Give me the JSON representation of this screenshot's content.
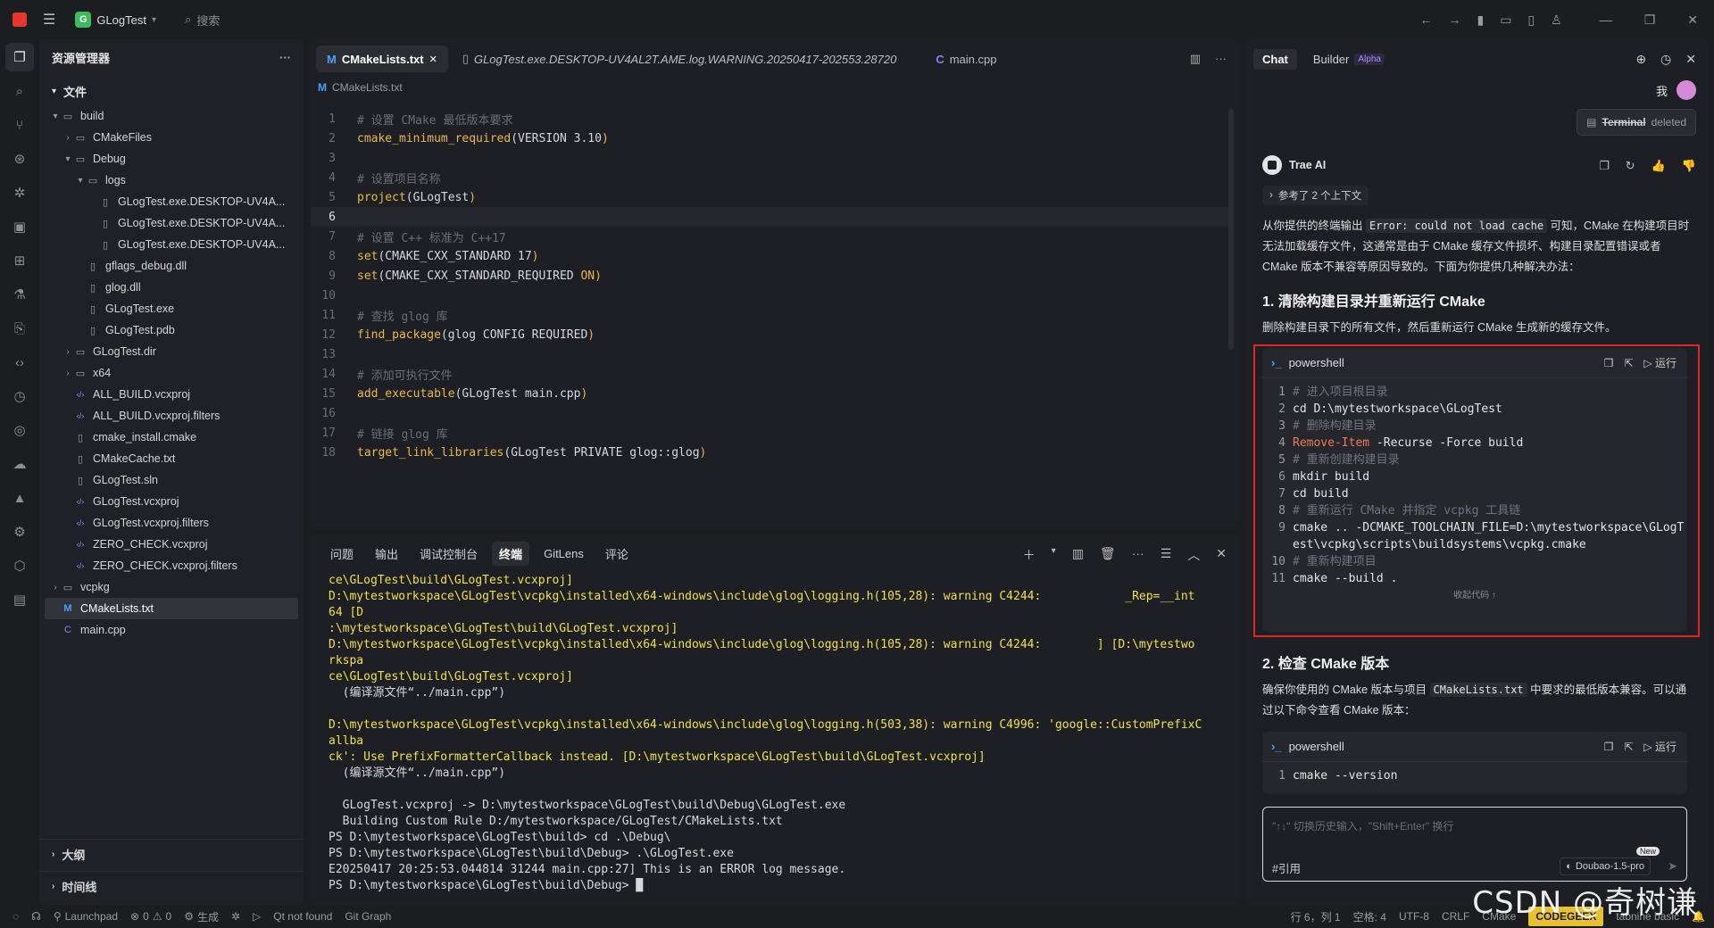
{
  "titlebar": {
    "project": "GLogTest",
    "project_badge": "G",
    "search_label": "搜索"
  },
  "explorer": {
    "header": "资源管理器",
    "section": "文件",
    "tree": [
      {
        "label": "build",
        "depth": 0,
        "kind": "folder",
        "open": true
      },
      {
        "label": "CMakeFiles",
        "depth": 1,
        "kind": "folder",
        "open": false
      },
      {
        "label": "Debug",
        "depth": 1,
        "kind": "folder",
        "open": true
      },
      {
        "label": "logs",
        "depth": 2,
        "kind": "folder",
        "open": true
      },
      {
        "label": "GLogTest.exe.DESKTOP-UV4A...",
        "depth": 3,
        "kind": "file"
      },
      {
        "label": "GLogTest.exe.DESKTOP-UV4A...",
        "depth": 3,
        "kind": "file"
      },
      {
        "label": "GLogTest.exe.DESKTOP-UV4A...",
        "depth": 3,
        "kind": "file"
      },
      {
        "label": "gflags_debug.dll",
        "depth": 2,
        "kind": "file"
      },
      {
        "label": "glog.dll",
        "depth": 2,
        "kind": "file"
      },
      {
        "label": "GLogTest.exe",
        "depth": 2,
        "kind": "file"
      },
      {
        "label": "GLogTest.pdb",
        "depth": 2,
        "kind": "file"
      },
      {
        "label": "GLogTest.dir",
        "depth": 1,
        "kind": "folder",
        "open": false
      },
      {
        "label": "x64",
        "depth": 1,
        "kind": "folder",
        "open": false
      },
      {
        "label": "ALL_BUILD.vcxproj",
        "depth": 1,
        "kind": "xml"
      },
      {
        "label": "ALL_BUILD.vcxproj.filters",
        "depth": 1,
        "kind": "xml"
      },
      {
        "label": "cmake_install.cmake",
        "depth": 1,
        "kind": "file"
      },
      {
        "label": "CMakeCache.txt",
        "depth": 1,
        "kind": "file"
      },
      {
        "label": "GLogTest.sln",
        "depth": 1,
        "kind": "file"
      },
      {
        "label": "GLogTest.vcxproj",
        "depth": 1,
        "kind": "xml"
      },
      {
        "label": "GLogTest.vcxproj.filters",
        "depth": 1,
        "kind": "xml"
      },
      {
        "label": "ZERO_CHECK.vcxproj",
        "depth": 1,
        "kind": "xml"
      },
      {
        "label": "ZERO_CHECK.vcxproj.filters",
        "depth": 1,
        "kind": "xml"
      },
      {
        "label": "vcpkg",
        "depth": 0,
        "kind": "folder",
        "open": false
      },
      {
        "label": "CMakeLists.txt",
        "depth": 0,
        "kind": "cmake",
        "selected": true
      },
      {
        "label": "main.cpp",
        "depth": 0,
        "kind": "cpp"
      }
    ],
    "outline": "大纲",
    "timeline": "时间线"
  },
  "editor": {
    "tabs": [
      {
        "label": "CMakeLists.txt",
        "icon": "M",
        "active": true
      },
      {
        "label": "GLogTest.exe.DESKTOP-UV4AL2T.AME.log.WARNING.20250417-202553.28720",
        "icon": "file",
        "italic": true
      },
      {
        "label": "main.cpp",
        "icon": "cpp"
      }
    ],
    "breadcrumb": "CMakeLists.txt",
    "lines": [
      {
        "n": "1",
        "parts": [
          {
            "c": "cm",
            "t": "# 设置 CMake 最低版本要求"
          }
        ]
      },
      {
        "n": "2",
        "parts": [
          {
            "c": "fn",
            "t": "cmake_minimum_required"
          },
          {
            "c": "tx",
            "t": "(VERSION 3.10"
          },
          {
            "c": "fn",
            "t": ")"
          }
        ]
      },
      {
        "n": "3",
        "parts": []
      },
      {
        "n": "4",
        "parts": [
          {
            "c": "cm",
            "t": "# 设置项目名称"
          }
        ]
      },
      {
        "n": "5",
        "parts": [
          {
            "c": "fn",
            "t": "project"
          },
          {
            "c": "tx",
            "t": "(GLogTest"
          },
          {
            "c": "fn",
            "t": ")"
          }
        ]
      },
      {
        "n": "6",
        "parts": [],
        "current": true
      },
      {
        "n": "7",
        "parts": [
          {
            "c": "cm",
            "t": "# 设置 C++ 标准为 C++17"
          }
        ]
      },
      {
        "n": "8",
        "parts": [
          {
            "c": "fn",
            "t": "set"
          },
          {
            "c": "tx",
            "t": "(CMAKE_CXX_STANDARD 17"
          },
          {
            "c": "fn",
            "t": ")"
          }
        ]
      },
      {
        "n": "9",
        "parts": [
          {
            "c": "fn",
            "t": "set"
          },
          {
            "c": "tx",
            "t": "(CMAKE_CXX_STANDARD_REQUIRED "
          },
          {
            "c": "kw",
            "t": "ON"
          },
          {
            "c": "fn",
            "t": ")"
          }
        ]
      },
      {
        "n": "10",
        "parts": []
      },
      {
        "n": "11",
        "parts": [
          {
            "c": "cm",
            "t": "# 查找 glog 库"
          }
        ]
      },
      {
        "n": "12",
        "parts": [
          {
            "c": "fn",
            "t": "find_package"
          },
          {
            "c": "tx",
            "t": "(glog CONFIG REQUIRED"
          },
          {
            "c": "fn",
            "t": ")"
          }
        ]
      },
      {
        "n": "13",
        "parts": []
      },
      {
        "n": "14",
        "parts": [
          {
            "c": "cm",
            "t": "# 添加可执行文件"
          }
        ]
      },
      {
        "n": "15",
        "parts": [
          {
            "c": "fn",
            "t": "add_executable"
          },
          {
            "c": "tx",
            "t": "(GLogTest main.cpp"
          },
          {
            "c": "fn",
            "t": ")"
          }
        ]
      },
      {
        "n": "16",
        "parts": []
      },
      {
        "n": "17",
        "parts": [
          {
            "c": "cm",
            "t": "# 链接 glog 库"
          }
        ]
      },
      {
        "n": "18",
        "parts": [
          {
            "c": "fn",
            "t": "target_link_libraries"
          },
          {
            "c": "tx",
            "t": "(GLogTest PRIVATE glog::glog"
          },
          {
            "c": "fn",
            "t": ")"
          }
        ]
      }
    ]
  },
  "panel": {
    "tabs": [
      "问题",
      "输出",
      "调试控制台",
      "终端",
      "GitLens",
      "评论"
    ],
    "active_tab": "终端",
    "terminal_lines": [
      {
        "c": "ty",
        "t": "ce\\GLogTest\\build\\GLogTest.vcxproj]"
      },
      {
        "c": "ty",
        "t": "D:\\mytestworkspace\\GLogTest\\vcpkg\\installed\\x64-windows\\include\\glog\\logging.h(105,28): warning C4244:            _Rep=__int"
      },
      {
        "c": "ty",
        "t": "64 [D"
      },
      {
        "c": "ty",
        "t": ":\\mytestworkspace\\GLogTest\\build\\GLogTest.vcxproj]"
      },
      {
        "c": "ty",
        "t": "D:\\mytestworkspace\\GLogTest\\vcpkg\\installed\\x64-windows\\include\\glog\\logging.h(105,28): warning C4244:        ] [D:\\mytestwo"
      },
      {
        "c": "ty",
        "t": "rkspa"
      },
      {
        "c": "ty",
        "t": "ce\\GLogTest\\build\\GLogTest.vcxproj]"
      },
      {
        "c": "tw2",
        "t": "  (编译源文件“../main.cpp”)"
      },
      {
        "c": "tw2",
        "t": ""
      },
      {
        "c": "ty",
        "t": "D:\\mytestworkspace\\GLogTest\\vcpkg\\installed\\x64-windows\\include\\glog\\logging.h(503,38): warning C4996: 'google::CustomPrefixC"
      },
      {
        "c": "ty",
        "t": "allba"
      },
      {
        "c": "ty",
        "t": "ck': Use PrefixFormatterCallback instead. [D:\\mytestworkspace\\GLogTest\\build\\GLogTest.vcxproj]"
      },
      {
        "c": "tw2",
        "t": "  (编译源文件“../main.cpp”)"
      },
      {
        "c": "tw2",
        "t": ""
      },
      {
        "c": "tw2",
        "t": "  GLogTest.vcxproj -> D:\\mytestworkspace\\GLogTest\\build\\Debug\\GLogTest.exe"
      },
      {
        "c": "tw2",
        "t": "  Building Custom Rule D:/mytestworkspace/GLogTest/CMakeLists.txt"
      },
      {
        "c": "tw2",
        "t": "PS D:\\mytestworkspace\\GLogTest\\build> cd .\\Debug\\"
      },
      {
        "c": "tw2",
        "t": "PS D:\\mytestworkspace\\GLogTest\\build\\Debug> .\\GLogTest.exe"
      },
      {
        "c": "tw2",
        "t": "E20250417 20:25:53.044814 31244 main.cpp:27] This is an ERROR log message."
      },
      {
        "c": "tw2",
        "t": "PS D:\\mytestworkspace\\GLogTest\\build\\Debug> █"
      }
    ]
  },
  "chat": {
    "tabs": {
      "chat": "Chat",
      "builder": "Builder",
      "alpha": "Alpha"
    },
    "user_label": "我",
    "deleted_chip": {
      "name": "Terminal",
      "status": "deleted"
    },
    "ai_name": "Trae AI",
    "ref_chip": "参考了 2 个上下文",
    "intro_pre": "从你提供的终端输出 ",
    "intro_code": "Error: could not load cache",
    "intro_post": " 可知，CMake 在构建项目时无法加载缓存文件，这通常是由于 CMake 缓存文件损坏、构建目录配置错误或者 CMake 版本不兼容等原因导致的。下面为你提供几种解决办法：",
    "h1": "1. 清除构建目录并重新运行 CMake",
    "p1": "删除构建目录下的所有文件，然后重新运行 CMake 生成新的缓存文件。",
    "block1": {
      "lang": "powershell",
      "run": "运行",
      "collapse": "收起代码 ↑",
      "lines": [
        {
          "n": "1",
          "t": "# 进入项目根目录",
          "cm": true
        },
        {
          "n": "2",
          "t": "cd D:\\mytestworkspace\\GLogTest"
        },
        {
          "n": "3",
          "t": "# 删除构建目录",
          "cm": true
        },
        {
          "n": "4",
          "red": "Remove-Item",
          "t": " -Recurse -Force build"
        },
        {
          "n": "5",
          "t": "# 重新创建构建目录",
          "cm": true
        },
        {
          "n": "6",
          "t": "mkdir build"
        },
        {
          "n": "7",
          "t": "cd build"
        },
        {
          "n": "8",
          "t": "# 重新运行 CMake 并指定 vcpkg 工具链",
          "cm": true
        },
        {
          "n": "9",
          "t": "cmake .. -DCMAKE_TOOLCHAIN_FILE=D:\\mytestworkspace\\GLogTest\\vcpkg\\scripts\\buildsystems\\vcpkg.cmake"
        },
        {
          "n": "10",
          "t": "# 重新构建项目",
          "cm": true
        },
        {
          "n": "11",
          "t": "cmake --build ."
        }
      ]
    },
    "h2": "2. 检查 CMake 版本",
    "p2_pre": "确保你使用的 CMake 版本与项目 ",
    "p2_code": "CMakeLists.txt",
    "p2_post": " 中要求的最低版本兼容。可以通过以下命令查看 CMake 版本：",
    "block2": {
      "lang": "powershell",
      "run": "运行",
      "lines": [
        {
          "n": "1",
          "t": "cmake --version"
        }
      ]
    },
    "input_placeholder": "\"↑↓\" 切换历史输入，\"Shift+Enter\" 换行",
    "input_ref": "#引用",
    "model": "Doubao-1.5-pro",
    "model_new": "New"
  },
  "status": {
    "launchpad": "Launchpad",
    "errors": "0",
    "warnings": "0",
    "build": "生成",
    "qt": "Qt not found",
    "gitgraph": "Git Graph",
    "position": "行 6，列 1",
    "spaces": "空格: 4",
    "encoding": "UTF-8",
    "eol": "CRLF",
    "lang": "CMake",
    "codegeex": "CODEGEEX",
    "tabnine": "tabnine basic"
  },
  "watermark": "CSDN @奇树谦"
}
